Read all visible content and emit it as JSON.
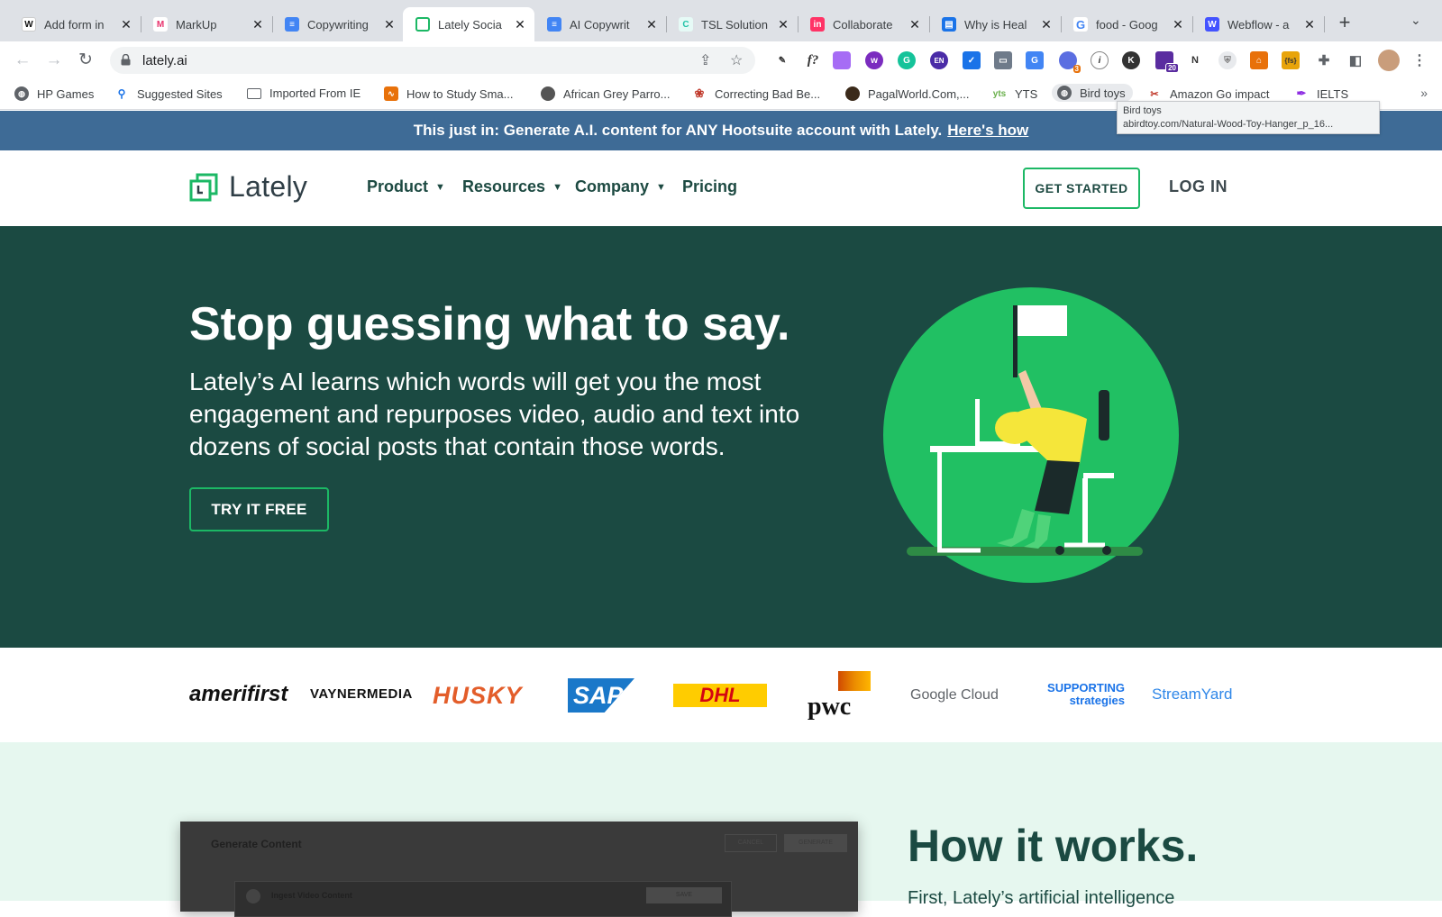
{
  "browser": {
    "tabs": [
      {
        "title": "Add form in",
        "icon": "W",
        "color": "#111111"
      },
      {
        "title": "MarkUp",
        "icon": "M",
        "color": "#e8336d"
      },
      {
        "title": "Copywriting",
        "icon": "doc",
        "color": "#4285f4"
      },
      {
        "title": "Lately Socia",
        "icon": "lately",
        "color": "#1cb865"
      },
      {
        "title": "AI Copywrit",
        "icon": "doc",
        "color": "#4285f4"
      },
      {
        "title": "TSL Solution",
        "icon": "C",
        "color": "#21c3a8"
      },
      {
        "title": "Collaborate",
        "icon": "in",
        "color": "#ff3366"
      },
      {
        "title": "Why is Heal",
        "icon": "H",
        "color": "#1a73e8"
      },
      {
        "title": "food - Goog",
        "icon": "G",
        "color": "#4285f4"
      },
      {
        "title": "Webflow - a",
        "icon": "W",
        "color": "#4353ff"
      }
    ],
    "url": "lately.ai",
    "bookmarks": [
      "HP Games",
      "Suggested Sites",
      "Imported From IE",
      "How to Study Sma...",
      "African Grey Parro...",
      "Correcting Bad Be...",
      "PagalWorld.Com,...",
      "YTS",
      "Bird toys",
      "Amazon Go impact",
      "IELTS"
    ],
    "tooltip": {
      "title": "Bird toys",
      "url": "abirdtoy.com/Natural-Wood-Toy-Hanger_p_16..."
    },
    "extension_badges": {
      "calendar": "3",
      "hat": "20"
    }
  },
  "banner": {
    "text": "This just in: Generate A.I. content for ANY Hootsuite account with Lately.",
    "link": "Here's how"
  },
  "nav": {
    "brand": "Lately",
    "items": [
      "Product",
      "Resources",
      "Company",
      "Pricing"
    ],
    "get_started": "GET STARTED",
    "login": "LOG IN"
  },
  "hero": {
    "headline": "Stop guessing what to say.",
    "subtext": "Lately’s AI learns which words will get you the most engagement and repurposes video, audio and text into dozens of social posts that contain those words.",
    "cta": "TRY IT FREE"
  },
  "client_logos": [
    "amerifirst",
    "VAYNERMEDIA",
    "HUSKY",
    "SAP",
    "DHL",
    "pwc",
    "Google Cloud",
    "SUPPORTING strategies",
    "StreamYard"
  ],
  "how": {
    "title": "How it works.",
    "subtext": "First, Lately’s artificial intelligence",
    "app_title": "Generate Content",
    "app_cancel": "CANCEL",
    "app_generate": "GENERATE",
    "app_step": "Ingest Video Content",
    "app_save": "SAVE"
  },
  "colors": {
    "banner": "#3e6b96",
    "hero_bg": "#1b4a42",
    "accent": "#1cb865",
    "section_bg": "#e6f7ef"
  }
}
